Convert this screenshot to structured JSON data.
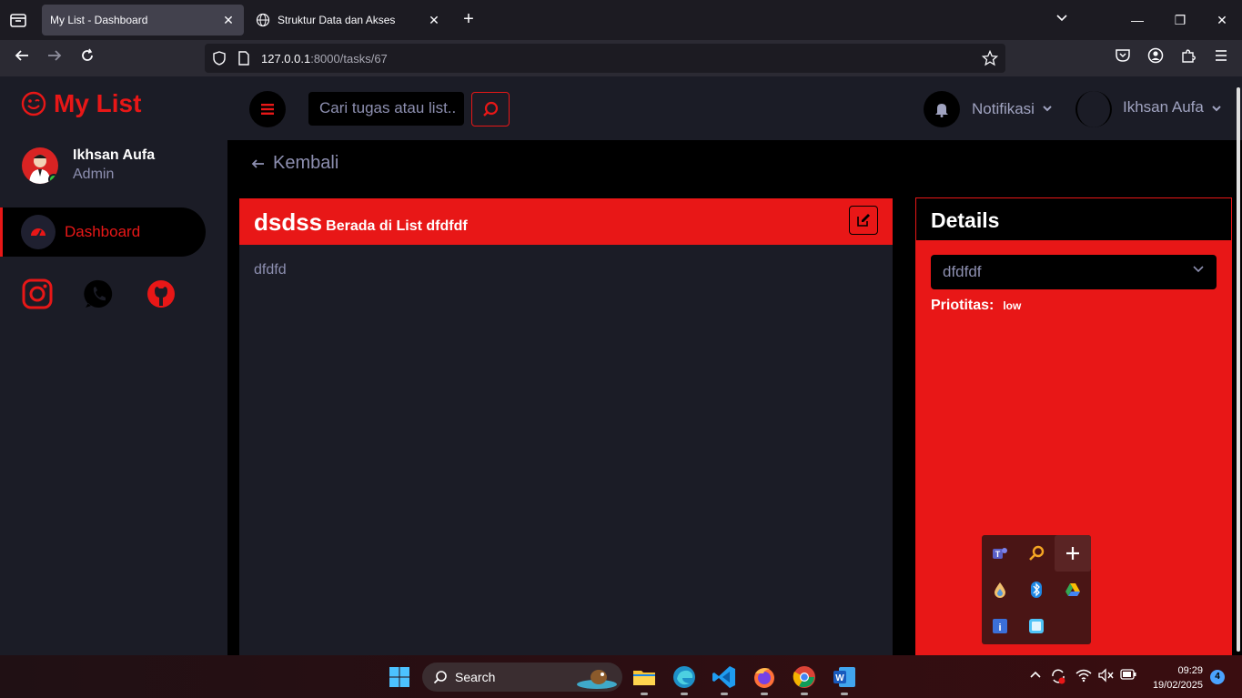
{
  "browser": {
    "tabs": [
      {
        "title": "My List - Dashboard",
        "active": true
      },
      {
        "title": "Struktur Data dan Akses",
        "active": false
      }
    ],
    "url_host": "127.0.0.1",
    "url_rest": ":8000/tasks/67"
  },
  "app": {
    "logo_text": "My List",
    "user": {
      "name": "Ikhsan Aufa",
      "role": "Admin"
    },
    "nav": {
      "dashboard": "Dashboard"
    },
    "socials": [
      "instagram-icon",
      "whatsapp-icon",
      "github-icon"
    ],
    "search_placeholder": "Cari tugas atau list..",
    "notif_label": "Notifikasi",
    "user_menu_label": "Ikhsan Aufa",
    "back_label": "Kembali",
    "task": {
      "title": "dsdss",
      "subtitle": "Berada di List dfdfdf",
      "description": "dfdfd"
    },
    "details": {
      "heading": "Details",
      "list_value": "dfdfdf",
      "priority_label": "Priotitas:",
      "priority_value": "low"
    },
    "accent_color": "#e81717"
  },
  "taskbar": {
    "search_label": "Search",
    "time": "09:29",
    "date": "19/02/2025",
    "notification_count": "4"
  }
}
